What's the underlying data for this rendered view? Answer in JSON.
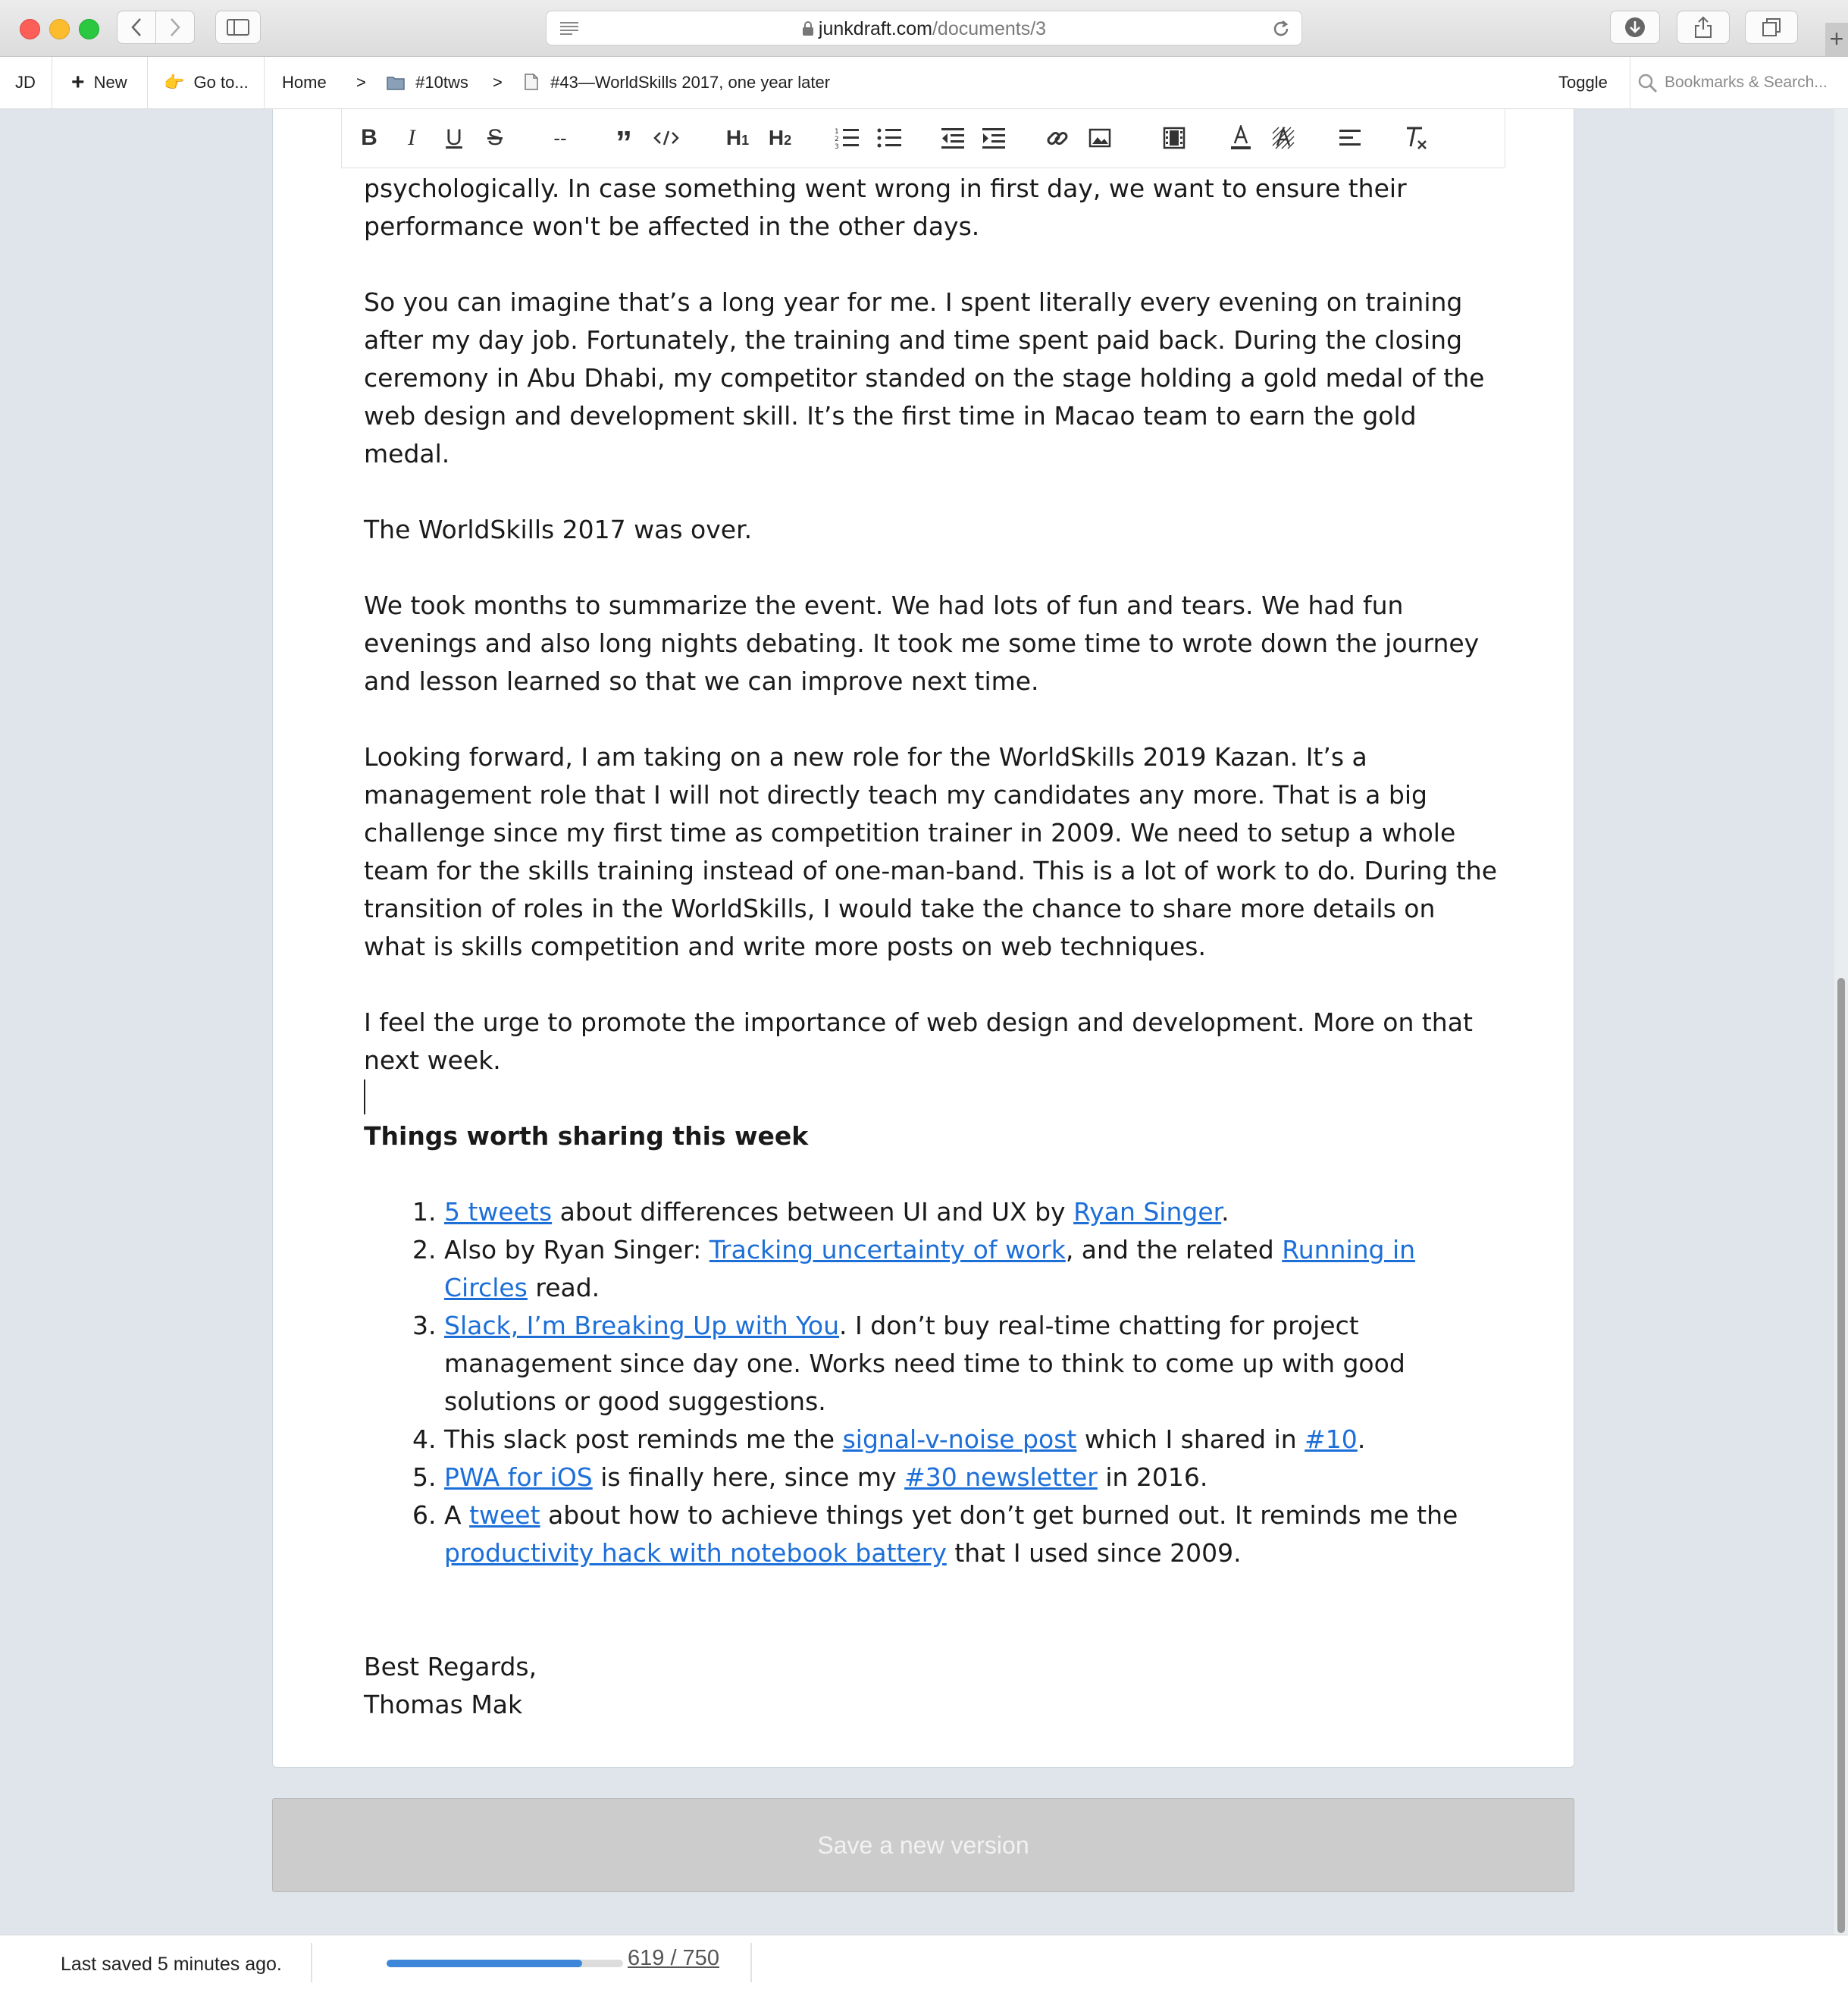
{
  "browser": {
    "url_host": "junkdraft.com",
    "url_path": "/documents/3"
  },
  "nav": {
    "user_initials": "JD",
    "new_label": "New",
    "goto_label": "Go to...",
    "home_label": "Home",
    "separator": ">",
    "folder_label": "#10tws",
    "document_label": "#43—WorldSkills 2017, one year later",
    "toggle_label": "Toggle",
    "search_placeholder": "Bookmarks & Search..."
  },
  "toolbar": {
    "hr_label": "--"
  },
  "document": {
    "paragraphs": [
      "psychologically. In case something went wrong in first day, we want to ensure their performance won't be affected in the other days.",
      "So you can imagine that’s a long year for me. I spent literally every evening on training after my day job. Fortunately, the training and time spent paid back. During the closing ceremony in Abu Dhabi, my competitor standed on the stage holding a gold medal of the web design and development skill. It’s the first time in Macao team to earn the gold medal.",
      "The WorldSkills 2017 was over.",
      "We took months to summarize the event. We had lots of fun and tears. We had fun evenings and also long nights debating. It took me some time to wrote down the journey and lesson learned so that we can improve next time.",
      "Looking forward, I am taking on a new role for the WorldSkills 2019 Kazan. It’s a management role that I will not directly teach my candidates any more. That is a big challenge since my first time as competition trainer in 2009. We need to setup a whole team for the skills training instead of one-man-band. This is a lot of work to do. During the transition of roles in the WorldSkills, I would take the chance to share more details on what is skills competition and write more posts on web techniques.",
      "I feel the urge to promote the importance of web design and development. More on that next week."
    ],
    "heading": "Things worth sharing this week",
    "list": [
      [
        {
          "type": "link",
          "text": "5 tweets"
        },
        {
          "type": "text",
          "text": " about differences between UI and UX by "
        },
        {
          "type": "link",
          "text": "Ryan Singer"
        },
        {
          "type": "text",
          "text": "."
        }
      ],
      [
        {
          "type": "text",
          "text": "Also by Ryan Singer: "
        },
        {
          "type": "link",
          "text": "Tracking uncertainty of work"
        },
        {
          "type": "text",
          "text": ", and the related "
        },
        {
          "type": "link",
          "text": "Running in Circles"
        },
        {
          "type": "text",
          "text": " read."
        }
      ],
      [
        {
          "type": "link",
          "text": "Slack, I’m Breaking Up with You"
        },
        {
          "type": "text",
          "text": ". I don’t buy real-time chatting for project management since day one. Works need time to think to come up with good solutions or good suggestions."
        }
      ],
      [
        {
          "type": "text",
          "text": "This slack post reminds me the "
        },
        {
          "type": "link",
          "text": "signal-v-noise post"
        },
        {
          "type": "text",
          "text": " which I shared in "
        },
        {
          "type": "link",
          "text": "#10"
        },
        {
          "type": "text",
          "text": "."
        }
      ],
      [
        {
          "type": "link",
          "text": "PWA for iOS"
        },
        {
          "type": "text",
          "text": " is finally here, since my "
        },
        {
          "type": "link",
          "text": "#30 newsletter"
        },
        {
          "type": "text",
          "text": " in 2016."
        }
      ],
      [
        {
          "type": "text",
          "text": "A "
        },
        {
          "type": "link",
          "text": "tweet"
        },
        {
          "type": "text",
          "text": " about how to achieve things yet don’t get burned out. It reminds me the "
        },
        {
          "type": "link",
          "text": "productivity hack with notebook battery"
        },
        {
          "type": "text",
          "text": " that I used since 2009."
        }
      ]
    ],
    "closing_line1": "Best Regards,",
    "closing_line2": "Thomas Mak"
  },
  "save_button_label": "Save a new version",
  "footer": {
    "last_saved": "Last saved 5 minutes ago.",
    "word_count_text": "619 / 750",
    "word_count": 619,
    "word_goal": 750
  },
  "colors": {
    "link": "#1d6fd8",
    "progress": "#3d86d9",
    "page_background": "#dfe5ea"
  }
}
